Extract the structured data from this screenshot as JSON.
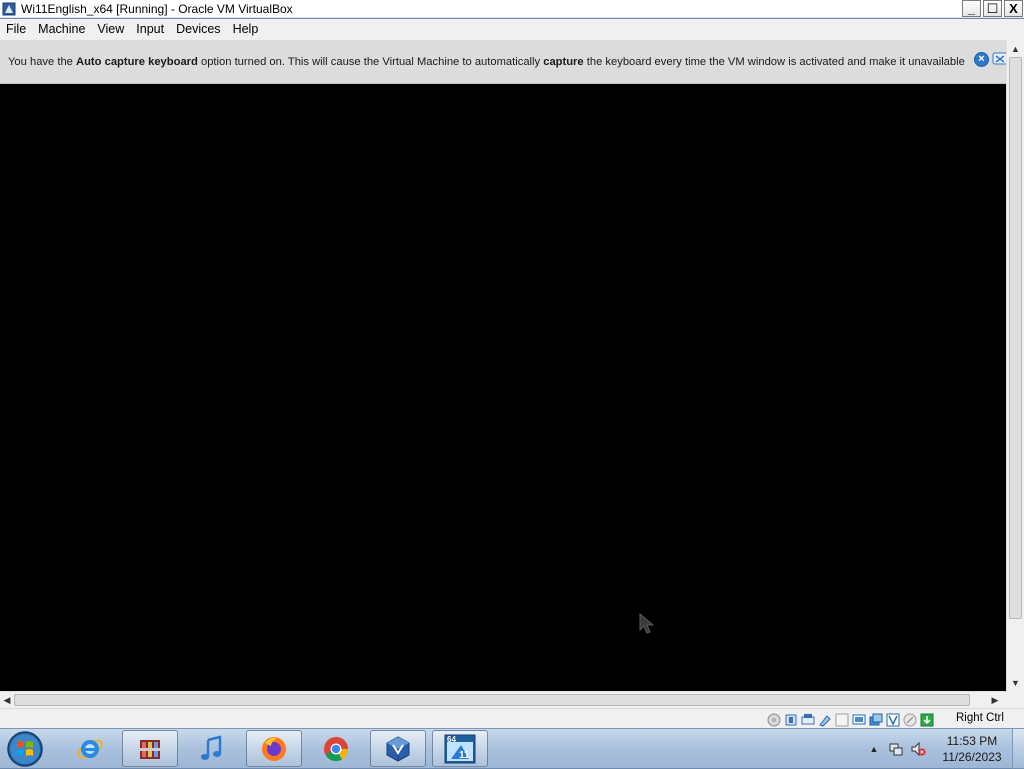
{
  "window": {
    "title": "Wi11English_x64 [Running] - Oracle VM VirtualBox",
    "icon": "virtualbox-icon",
    "controls": {
      "minimize_label": "_",
      "maximize_label": "☐",
      "close_label": "X"
    }
  },
  "menubar": {
    "items": [
      {
        "label": "File"
      },
      {
        "label": "Machine"
      },
      {
        "label": "View"
      },
      {
        "label": "Input"
      },
      {
        "label": "Devices"
      },
      {
        "label": "Help"
      }
    ]
  },
  "notification": {
    "text_1": "You have the ",
    "bold_1": "Auto capture keyboard",
    "text_2": " option turned on. This will cause the Virtual Machine to automatically ",
    "bold_2": "capture",
    "text_3": " the keyboard every time the VM window is activated and make it unavailable to",
    "close_label": "×"
  },
  "scrollbars": {
    "up_label": "▲",
    "down_label": "▼",
    "left_label": "◀",
    "right_label": "▶"
  },
  "statusbar": {
    "host_key": "Right Ctrl",
    "icons": [
      "hard-disk-icon",
      "optical-drive-icon",
      "audio-icon",
      "network-icon",
      "usb-icon",
      "shared-folders-icon",
      "display-icon",
      "video-capture-icon",
      "recording-icon",
      "cpu-icon",
      "mouse-integration-icon",
      "keyboard-icon"
    ]
  },
  "taskbar": {
    "apps": [
      {
        "name": "internet-explorer-icon"
      },
      {
        "name": "archive-manager-icon"
      },
      {
        "name": "itunes-icon"
      },
      {
        "name": "firefox-icon"
      },
      {
        "name": "chrome-icon"
      },
      {
        "name": "virtualbox-icon"
      },
      {
        "name": "virtualbox-vm-icon",
        "badge_top": "64",
        "badge_bottom": "11"
      }
    ],
    "clock": {
      "time": "11:53 PM",
      "date": "11/26/2023"
    },
    "tray_expand": "▲"
  },
  "colors": {
    "notification_bg": "#dcdcdc",
    "vm_screen_bg": "#000000",
    "taskbar_top": "#c9d9ec",
    "accent_blue": "#2f78c8"
  }
}
